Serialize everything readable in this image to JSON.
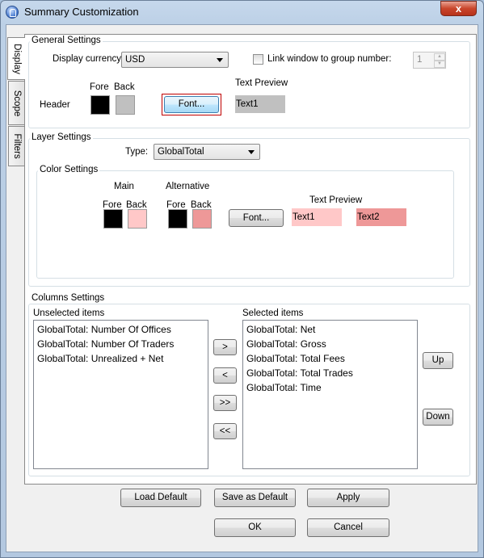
{
  "window": {
    "title": "Summary Customization",
    "close_glyph": "x"
  },
  "tabs": [
    {
      "label": "Display",
      "selected": true
    },
    {
      "label": "Scope",
      "selected": false
    },
    {
      "label": "Filters",
      "selected": false
    }
  ],
  "general": {
    "title": "General Settings",
    "currency_label": "Display currency:",
    "currency_value": "USD",
    "link_label": "Link window to group number:",
    "link_checked": false,
    "link_number": "1",
    "fore_label": "Fore",
    "back_label": "Back",
    "header_label": "Header",
    "font_button": "Font...",
    "preview_label": "Text Preview",
    "preview_text": "Text1",
    "colors": {
      "fore": "#000000",
      "back": "#c0c0c0",
      "preview_bg": "#c0c0c0"
    }
  },
  "layer": {
    "title": "Layer Settings",
    "type_label": "Type:",
    "type_value": "GlobalTotal",
    "color_title": "Color Settings",
    "main_label": "Main",
    "alt_label": "Alternative",
    "fore_label": "Fore",
    "back_label": "Back",
    "alt_fore_label": "Fore",
    "alt_back_label": "Back",
    "font_button": "Font...",
    "preview_label": "Text Preview",
    "preview1": "Text1",
    "preview2": "Text2",
    "colors": {
      "main_fore": "#000000",
      "main_back": "#ffc8c8",
      "alt_fore": "#000000",
      "alt_back": "#ee9898"
    }
  },
  "columns": {
    "title": "Columns Settings",
    "unselected_label": "Unselected items",
    "selected_label": "Selected items",
    "unselected": [
      "GlobalTotal: Number Of Offices",
      "GlobalTotal: Number Of Traders",
      "GlobalTotal: Unrealized + Net"
    ],
    "selected": [
      "GlobalTotal: Net",
      "GlobalTotal: Gross",
      "GlobalTotal: Total Fees",
      "GlobalTotal: Total Trades",
      "GlobalTotal: Time"
    ],
    "move_right": ">",
    "move_left": "<",
    "move_all_right": ">>",
    "move_all_left": "<<",
    "up": "Up",
    "down": "Down"
  },
  "footer": {
    "load_default": "Load Default",
    "save_default": "Save as Default",
    "apply": "Apply",
    "ok": "OK",
    "cancel": "Cancel"
  }
}
